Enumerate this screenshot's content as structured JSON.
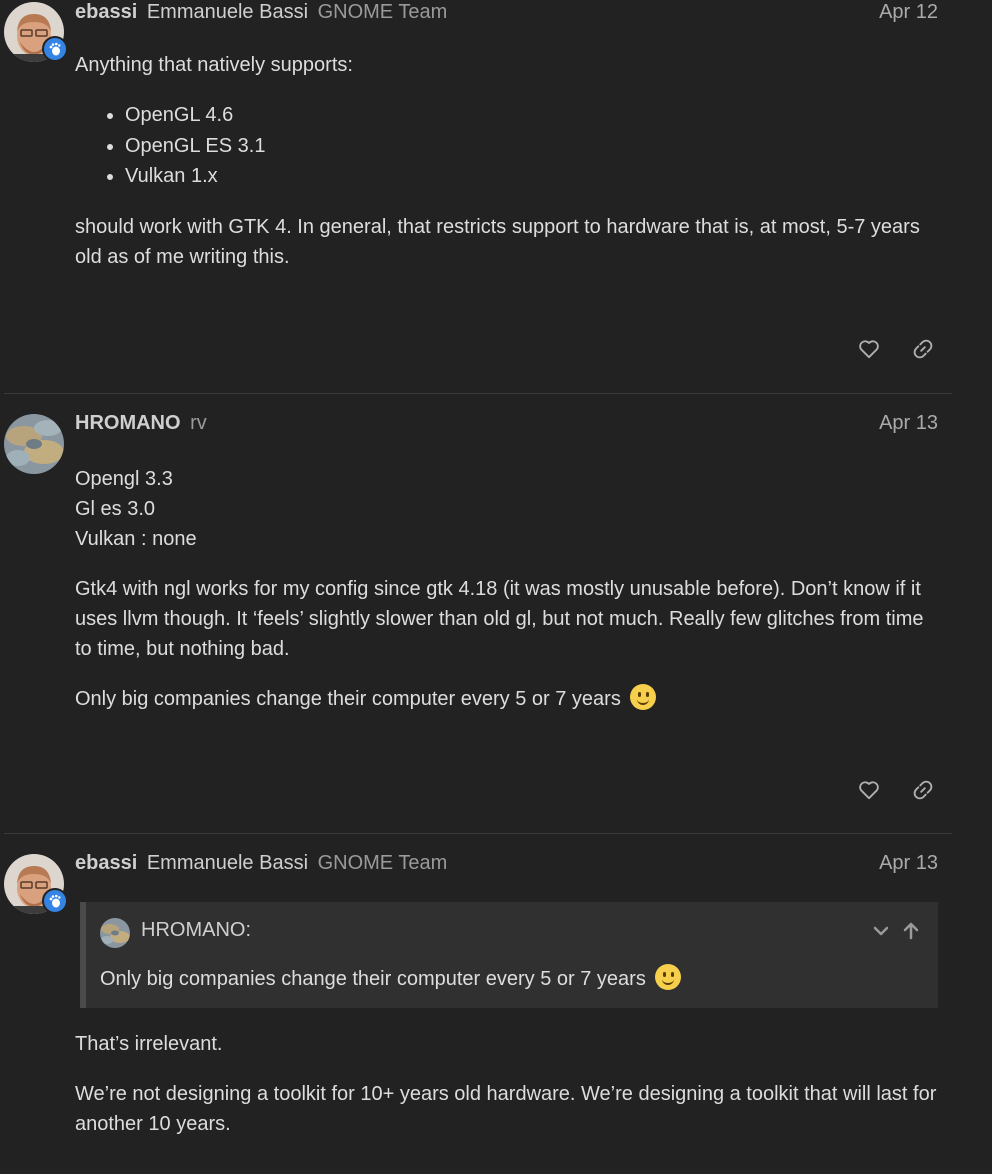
{
  "posts": [
    {
      "username": "ebassi",
      "full_name": "Emmanuele Bassi",
      "user_title": "GNOME Team",
      "date": "Apr 12",
      "intro": "Anything that natively supports:",
      "list": [
        "OpenGL 4.6",
        "OpenGL ES 3.1",
        "Vulkan 1.x"
      ],
      "outro": "should work with GTK 4. In general, that restricts support to hardware that is, at most, 5-7 years old as of me writing this."
    },
    {
      "username": "HROMANO",
      "user_title": "rv",
      "date": "Apr 13",
      "lines": [
        "Opengl 3.3",
        "Gl es 3.0",
        "Vulkan : none"
      ],
      "paragraph": "Gtk4 with ngl works for my config since gtk 4.18 (it was mostly unusable before). Don’t know if it uses llvm though. It ‘feels’ slightly slower than old gl, but not much. Really few glitches from time to time, but nothing bad.",
      "closing": "Only big companies change their computer every 5 or 7 years"
    },
    {
      "username": "ebassi",
      "full_name": "Emmanuele Bassi",
      "user_title": "GNOME Team",
      "date": "Apr 13",
      "quote": {
        "author": "HROMANO:",
        "text": "Only big companies change their computer every 5 or 7 years"
      },
      "paragraphs": [
        "That’s irrelevant.",
        "We’re not designing a toolkit for 10+ years old hardware. We’re designing a toolkit that will last for another 10 years."
      ]
    }
  ],
  "icons": {
    "like": "heart-icon",
    "share": "link-icon",
    "expand": "chevron-down-icon",
    "jump": "arrow-up-icon",
    "emoji": "slightly-smiling-face"
  },
  "colors": {
    "background": "#222222",
    "flair": "#3584e4",
    "emoji": "#f6d04d"
  }
}
